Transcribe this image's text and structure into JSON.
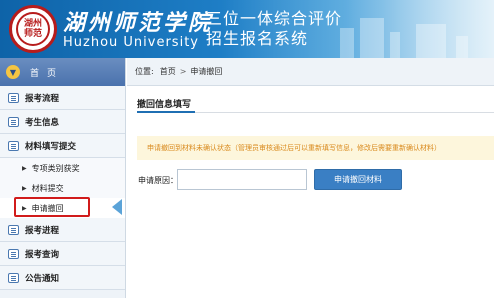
{
  "header": {
    "logo_text": "湖州\n师范",
    "school_name_cn": "湖州师范学院",
    "school_name_en": "Huzhou University",
    "system_title_line1": "三位一体综合评价",
    "system_title_line2": "招生报名系统"
  },
  "sidebar": {
    "home_label": "首页",
    "items": [
      {
        "label": "报考流程",
        "icon": "list-icon"
      },
      {
        "label": "考生信息",
        "icon": "edit-icon"
      },
      {
        "label": "材料填写提交",
        "icon": "form-icon"
      }
    ],
    "sub_items": [
      {
        "label": "专项类别获奖"
      },
      {
        "label": "材料提交"
      },
      {
        "label": "申请撤回"
      }
    ],
    "items_after": [
      {
        "label": "报考进程",
        "icon": "progress-icon"
      },
      {
        "label": "报考查询",
        "icon": "search-icon"
      },
      {
        "label": "公告通知",
        "icon": "notice-icon"
      }
    ]
  },
  "breadcrumb": {
    "position_label": "位置:",
    "home": "首页",
    "sep": ">",
    "current": "申请撤回"
  },
  "panel": {
    "title": "撤回信息填写",
    "notice": "申请撤回到材料未确认状态（管理员审核通过后可以重新填写信息，修改后需要重新确认材料）",
    "reason_label": "申请原因：",
    "reason_value": "",
    "submit_label": "申请撤回材料"
  },
  "colors": {
    "header_blue": "#1e7ec6",
    "notice_text": "#d98a1e",
    "button_blue": "#3a7fc4",
    "highlight_red": "#d11b1b"
  }
}
